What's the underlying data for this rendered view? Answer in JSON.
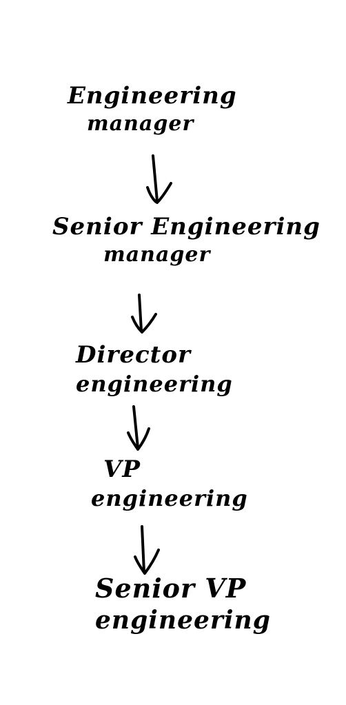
{
  "diagram": {
    "nodes": [
      {
        "id": "engineering-manager",
        "lines": [
          "Engineering",
          "manager"
        ]
      },
      {
        "id": "senior-engineering-manager",
        "lines": [
          "Senior Engineering",
          "manager"
        ]
      },
      {
        "id": "director-engineering",
        "lines": [
          "Director",
          "engineering"
        ]
      },
      {
        "id": "vp-engineering",
        "lines": [
          "VP",
          "engineering"
        ]
      },
      {
        "id": "senior-vp-engineering",
        "lines": [
          "Senior VP",
          "engineering"
        ]
      }
    ],
    "edges": [
      {
        "from": "engineering-manager",
        "to": "senior-engineering-manager"
      },
      {
        "from": "senior-engineering-manager",
        "to": "director-engineering"
      },
      {
        "from": "director-engineering",
        "to": "vp-engineering"
      },
      {
        "from": "vp-engineering",
        "to": "senior-vp-engineering"
      }
    ],
    "ink_color": "#000000",
    "background_color": "#ffffff"
  }
}
